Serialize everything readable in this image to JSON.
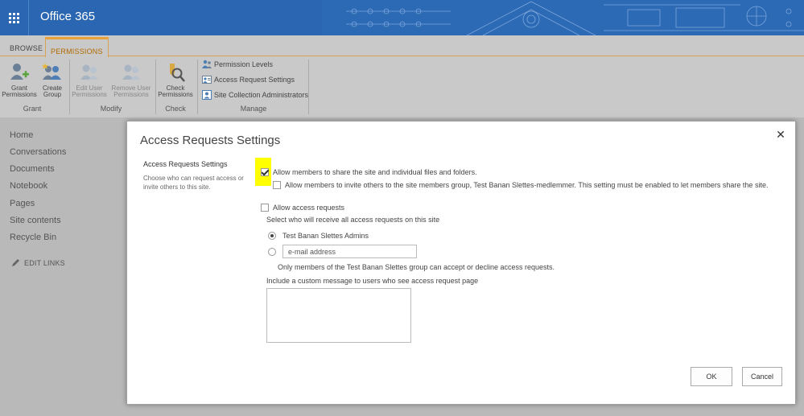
{
  "suite": {
    "title": "Office 365",
    "waffle_icon": "app-launcher-icon"
  },
  "ribbon": {
    "tabs": [
      {
        "label": "BROWSE"
      },
      {
        "label": "PERMISSIONS"
      }
    ],
    "grant": {
      "grant_permissions": [
        "Grant",
        "Permissions"
      ],
      "create_group": [
        "Create",
        "Group"
      ],
      "label": "Grant"
    },
    "modify": {
      "edit_user_permissions": [
        "Edit User",
        "Permissions"
      ],
      "remove_user_permissions": [
        "Remove User",
        "Permissions"
      ],
      "label": "Modify"
    },
    "check": {
      "check_permissions": [
        "Check",
        "Permissions"
      ],
      "label": "Check"
    },
    "manage": {
      "items": [
        "Permission Levels",
        "Access Request Settings",
        "Site Collection Administrators"
      ],
      "label": "Manage"
    }
  },
  "nav": {
    "items": [
      "Home",
      "Conversations",
      "Documents",
      "Notebook",
      "Pages",
      "Site contents",
      "Recycle Bin"
    ],
    "edit_links": "EDIT LINKS"
  },
  "dialog": {
    "title": "Access Requests Settings",
    "close": "✕",
    "section_title": "Access Requests Settings",
    "section_desc": "Choose who can request access or invite others to this site.",
    "allow_share": {
      "label": "Allow members to share the site and individual files and folders.",
      "checked": true
    },
    "allow_invite": {
      "label": "Allow members to invite others to the site members group, Test Banan Slettes-medlemmer. This setting must be enabled to let members share the site.",
      "checked": false
    },
    "allow_access_requests": {
      "label": "Allow access requests",
      "checked": false
    },
    "receive_label": "Select who will receive all access requests on this site",
    "radio_admins": {
      "label": "Test Banan Slettes Admins",
      "selected": true
    },
    "radio_email": {
      "placeholder": "e-mail address",
      "selected": false
    },
    "only_members_note": "Only members of the Test Banan Slettes group can accept or decline access requests.",
    "custom_message_label": "Include a custom message to users who see access request page",
    "custom_message_value": "",
    "ok_label": "OK",
    "cancel_label": "Cancel"
  },
  "colors": {
    "suite_bar": "#2a66b1",
    "accent_tab": "#e9a13c",
    "highlight": "#ffff00",
    "ribbon_bg": "#c9c9c9"
  }
}
